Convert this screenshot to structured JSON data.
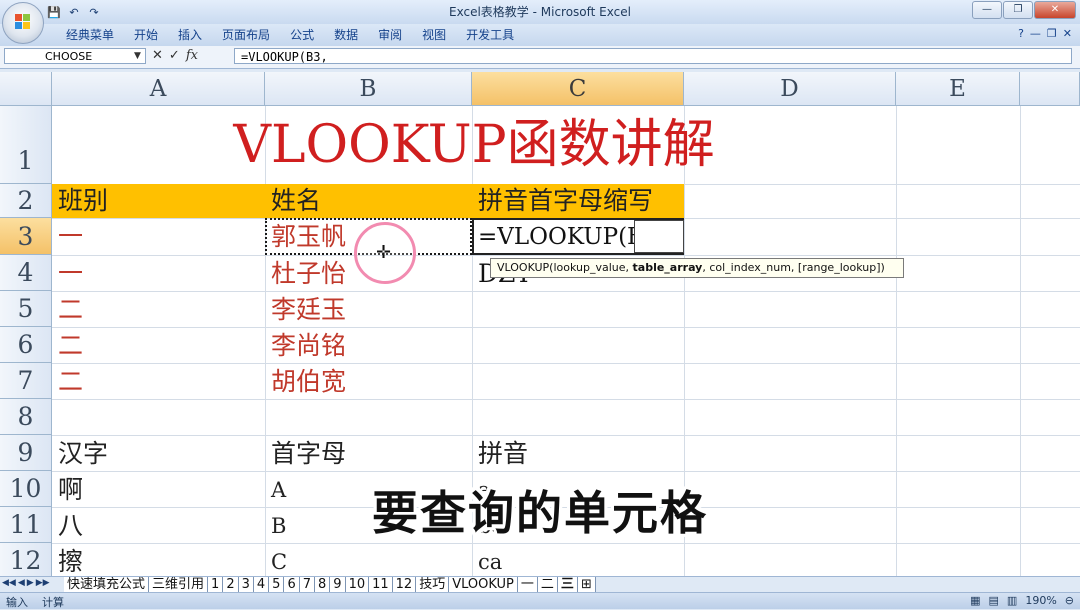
{
  "window": {
    "title": "Excel表格教学 - Microsoft Excel",
    "controls": {
      "minimize": "—",
      "restore": "❐",
      "close": "✕"
    }
  },
  "quick_access": {
    "save_icon": "💾",
    "undo_icon": "↶",
    "redo_icon": "↷"
  },
  "menu": {
    "items": [
      "经典菜单",
      "开始",
      "插入",
      "页面布局",
      "公式",
      "数据",
      "审阅",
      "视图",
      "开发工具"
    ]
  },
  "formula_bar": {
    "name_box": "CHOOSE",
    "cancel": "✕",
    "enter": "✓",
    "fx": "fx",
    "formula": "=VLOOKUP(B3,"
  },
  "columns": [
    "A",
    "B",
    "C",
    "D",
    "E"
  ],
  "rows": [
    "1",
    "2",
    "3",
    "4",
    "5",
    "6",
    "7",
    "8",
    "9",
    "10",
    "11",
    "12"
  ],
  "sheet": {
    "title": "VLOOKUP函数讲解",
    "header": {
      "a": "班别",
      "b": "姓名",
      "c": "拼音首字母缩写"
    },
    "data_rows": [
      {
        "a": "一",
        "b": "郭玉帆",
        "c": "=VLOOKUP(B3,"
      },
      {
        "a": "一",
        "b": "杜子怡",
        "c": "DZY"
      },
      {
        "a": "二",
        "b": "李廷玉",
        "c": ""
      },
      {
        "a": "二",
        "b": "李尚铭",
        "c": ""
      },
      {
        "a": "二",
        "b": "胡伯宽",
        "c": ""
      }
    ],
    "lookup_header": {
      "a": "汉字",
      "b": "首字母",
      "c": "拼音"
    },
    "lookup_rows": [
      {
        "a": "啊",
        "b": "A",
        "c": "a"
      },
      {
        "a": "八",
        "b": "B",
        "c": "ba"
      },
      {
        "a": "擦",
        "b": "C",
        "c": "ca"
      }
    ]
  },
  "tooltip": {
    "prefix": "VLOOKUP(lookup_value, ",
    "bold": "table_array",
    "suffix": ", col_index_num, [range_lookup])"
  },
  "caption": "要查询的单元格",
  "sheet_tabs": [
    "快速填充公式",
    "三维引用",
    "1",
    "2",
    "3",
    "4",
    "5",
    "6",
    "7",
    "8",
    "9",
    "10",
    "11",
    "12",
    "技巧",
    "VLOOKUP",
    "一",
    "二",
    "三"
  ],
  "status": {
    "mode": "输入",
    "calc": "计算",
    "zoom": "190%"
  },
  "colors": {
    "title_red": "#d01f1f",
    "data_red": "#c0392b",
    "header_fill": "#ffc000",
    "active_header": "#f4c168"
  }
}
